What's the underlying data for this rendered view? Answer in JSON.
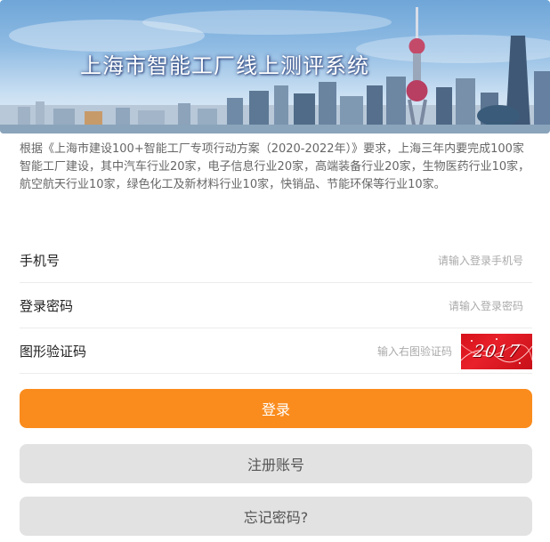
{
  "banner": {
    "title": "上海市智能工厂线上测评系统"
  },
  "intro": "根据《上海市建设100+智能工厂专项行动方案（2020-2022年）》要求，上海三年内要完成100家智能工厂建设，其中汽车行业20家，电子信息行业20家，高端装备行业20家，生物医药行业10家，航空航天行业10家，绿色化工及新材料行业10家，快销品、节能环保等行业10家。",
  "form": {
    "phone": {
      "label": "手机号",
      "placeholder": "请输入登录手机号"
    },
    "password": {
      "label": "登录密码",
      "placeholder": "请输入登录密码"
    },
    "captcha": {
      "label": "图形验证码",
      "placeholder": "输入右图验证码",
      "image_text": "2017"
    }
  },
  "buttons": {
    "login": "登录",
    "register": "注册账号",
    "forgot": "忘记密码?"
  },
  "colors": {
    "primary": "#fa8c1d",
    "secondary": "#e2e2e2",
    "captcha_bg": "#d6121a"
  }
}
